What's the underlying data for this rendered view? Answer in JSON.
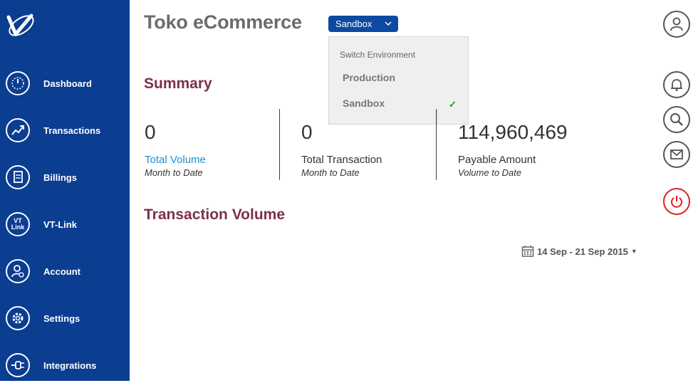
{
  "app": {
    "title": "Toko eCommerce"
  },
  "environment": {
    "selected": "Sandbox",
    "dropdown_header": "Switch Environment",
    "options": [
      "Production",
      "Sandbox"
    ],
    "checked": "Sandbox"
  },
  "sidebar": {
    "items": [
      {
        "label": "Dashboard",
        "icon": "dashboard-gauge-icon"
      },
      {
        "label": "Transactions",
        "icon": "transactions-chart-icon"
      },
      {
        "label": "Billings",
        "icon": "billing-document-icon"
      },
      {
        "label": "VT-Link",
        "icon": "vt-link-icon",
        "icon_text": "VT Link"
      },
      {
        "label": "Account",
        "icon": "account-user-icon"
      },
      {
        "label": "Settings",
        "icon": "settings-gear-icon"
      },
      {
        "label": "Integrations",
        "icon": "integrations-plug-icon"
      }
    ]
  },
  "summary": {
    "title": "Summary",
    "metrics": [
      {
        "value": "0",
        "label": "Total Volume",
        "sub": "Month to Date"
      },
      {
        "value": "0",
        "label": "Total Transaction",
        "sub": "Month to Date"
      },
      {
        "value": "114,960,469",
        "label": "Payable Amount",
        "sub": "Volume to Date"
      }
    ]
  },
  "transaction_volume": {
    "title": "Transaction Volume",
    "date_range": "14 Sep - 21 Sep 2015"
  },
  "right_bar": {
    "icons": [
      "user-profile-icon",
      "bell-icon",
      "search-icon",
      "mail-icon",
      "power-icon"
    ]
  },
  "colors": {
    "sidebar_bg": "#0b3d91",
    "accent_blue": "#1a8fd6",
    "section_title": "#7b3050",
    "power_red": "#e02020",
    "check_green": "#1a9a1a"
  }
}
